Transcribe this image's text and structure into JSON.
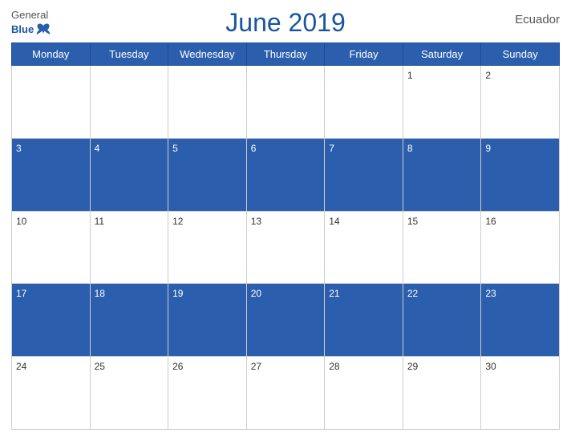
{
  "header": {
    "logo_general": "General",
    "logo_blue": "Blue",
    "title": "June 2019",
    "country": "Ecuador"
  },
  "days_of_week": [
    "Monday",
    "Tuesday",
    "Wednesday",
    "Thursday",
    "Friday",
    "Saturday",
    "Sunday"
  ],
  "weeks": [
    [
      null,
      null,
      null,
      null,
      null,
      1,
      2
    ],
    [
      3,
      4,
      5,
      6,
      7,
      8,
      9
    ],
    [
      10,
      11,
      12,
      13,
      14,
      15,
      16
    ],
    [
      17,
      18,
      19,
      20,
      21,
      22,
      23
    ],
    [
      24,
      25,
      26,
      27,
      28,
      29,
      30
    ]
  ],
  "colors": {
    "header_bg": "#2b5fad",
    "title_color": "#1a56a0",
    "row_dark_bg": "#2b5fad",
    "row_light_bg": "#ffffff"
  }
}
